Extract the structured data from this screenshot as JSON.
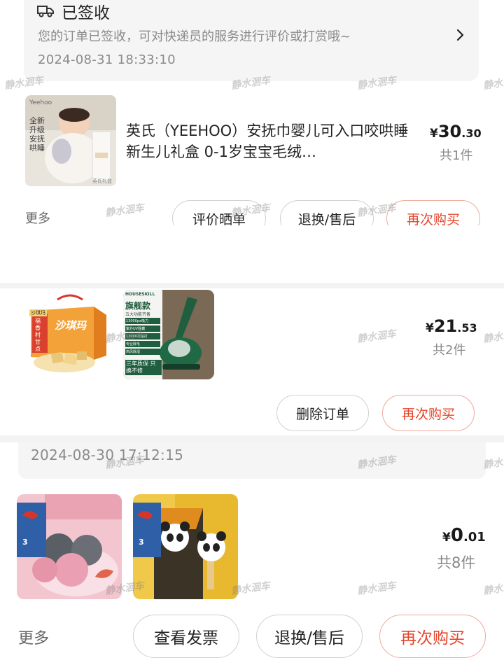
{
  "order1": {
    "logistics": {
      "status": "已签收",
      "message": "您的订单已签收，可对快递员的服务进行评价或打赏哦~",
      "time": "2024-08-31 18:33:10",
      "icon": "truck-icon"
    },
    "product": {
      "title": "英氏（YEEHOO）安抚巾婴儿可入口咬哄睡新生儿礼盒 0-1岁宝宝毛绒…",
      "image_text": {
        "brand": "Yeehoo",
        "tagline_chars": [
          "全",
          "新",
          "升",
          "级",
          "安",
          "抚",
          "哄",
          "睡"
        ],
        "box_label": "英氏礼盒"
      }
    },
    "price": {
      "currency": "¥",
      "int": "30",
      "dec": ".30"
    },
    "count": "共1件",
    "more": "更多",
    "buttons": {
      "review": "评价晒单",
      "return": "退换/售后",
      "rebuy": "再次购买"
    }
  },
  "order2": {
    "images": [
      {
        "name": "shaqima-box-image",
        "title": "沙琪玛",
        "side_text": "福香村甘点",
        "top_tag": "沙琪玛"
      },
      {
        "name": "vacuum-image",
        "brand": "HOUSESKILL",
        "title": "旗舰款",
        "sub": "五大功能齐备",
        "features": [
          "13000pa吸力",
          "紫外UV除螨",
          "13000次拍打",
          "专业除毛",
          "热风除湿"
        ],
        "warranty": "三年质保 只换不修"
      }
    ],
    "price": {
      "currency": "¥",
      "int": "21",
      "dec": ".53"
    },
    "count": "共2件",
    "buttons": {
      "delete": "删除订单",
      "rebuy": "再次购买"
    }
  },
  "order3": {
    "time": "2024-08-30 17:12:15",
    "images": [
      {
        "name": "mooncake-image",
        "badge": "3"
      },
      {
        "name": "panda-popsicle-image",
        "badge": "3"
      }
    ],
    "price": {
      "currency": "¥",
      "int": "0",
      "dec": ".01"
    },
    "count": "共8件",
    "more": "更多",
    "buttons": {
      "invoice": "查看发票",
      "return": "退换/售后",
      "rebuy": "再次购买"
    }
  },
  "watermark": "静水洄车",
  "colors": {
    "accent_red": "#e64529",
    "red_border": "#f0a99c",
    "gray_text": "#8a8a8a",
    "card_bg": "#f5f5f5"
  }
}
